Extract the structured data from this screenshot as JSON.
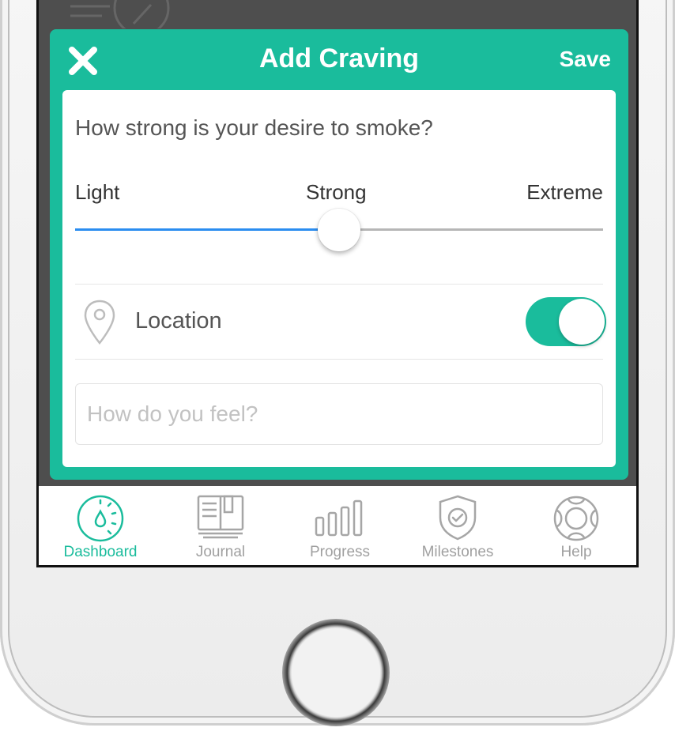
{
  "modal": {
    "title": "Add Craving",
    "save_label": "Save",
    "close_icon": "close-icon",
    "accent_color": "#1abc9c"
  },
  "craving": {
    "question": "How strong is your desire to smoke?",
    "labels": {
      "light": "Light",
      "strong": "Strong",
      "extreme": "Extreme"
    },
    "intensity_fraction": 0.5,
    "fill_color": "#2b8df0"
  },
  "location": {
    "icon": "location-pin-icon",
    "label": "Location",
    "enabled": true
  },
  "feelings": {
    "placeholder": "How do you feel?",
    "value": ""
  },
  "tabbar": {
    "items": [
      {
        "label": "Dashboard",
        "icon": "dashboard-gauge-icon",
        "active": true
      },
      {
        "label": "Journal",
        "icon": "journal-book-icon",
        "active": false
      },
      {
        "label": "Progress",
        "icon": "progress-bars-icon",
        "active": false
      },
      {
        "label": "Milestones",
        "icon": "shield-check-icon",
        "active": false
      },
      {
        "label": "Help",
        "icon": "lifebuoy-icon",
        "active": false
      }
    ]
  }
}
